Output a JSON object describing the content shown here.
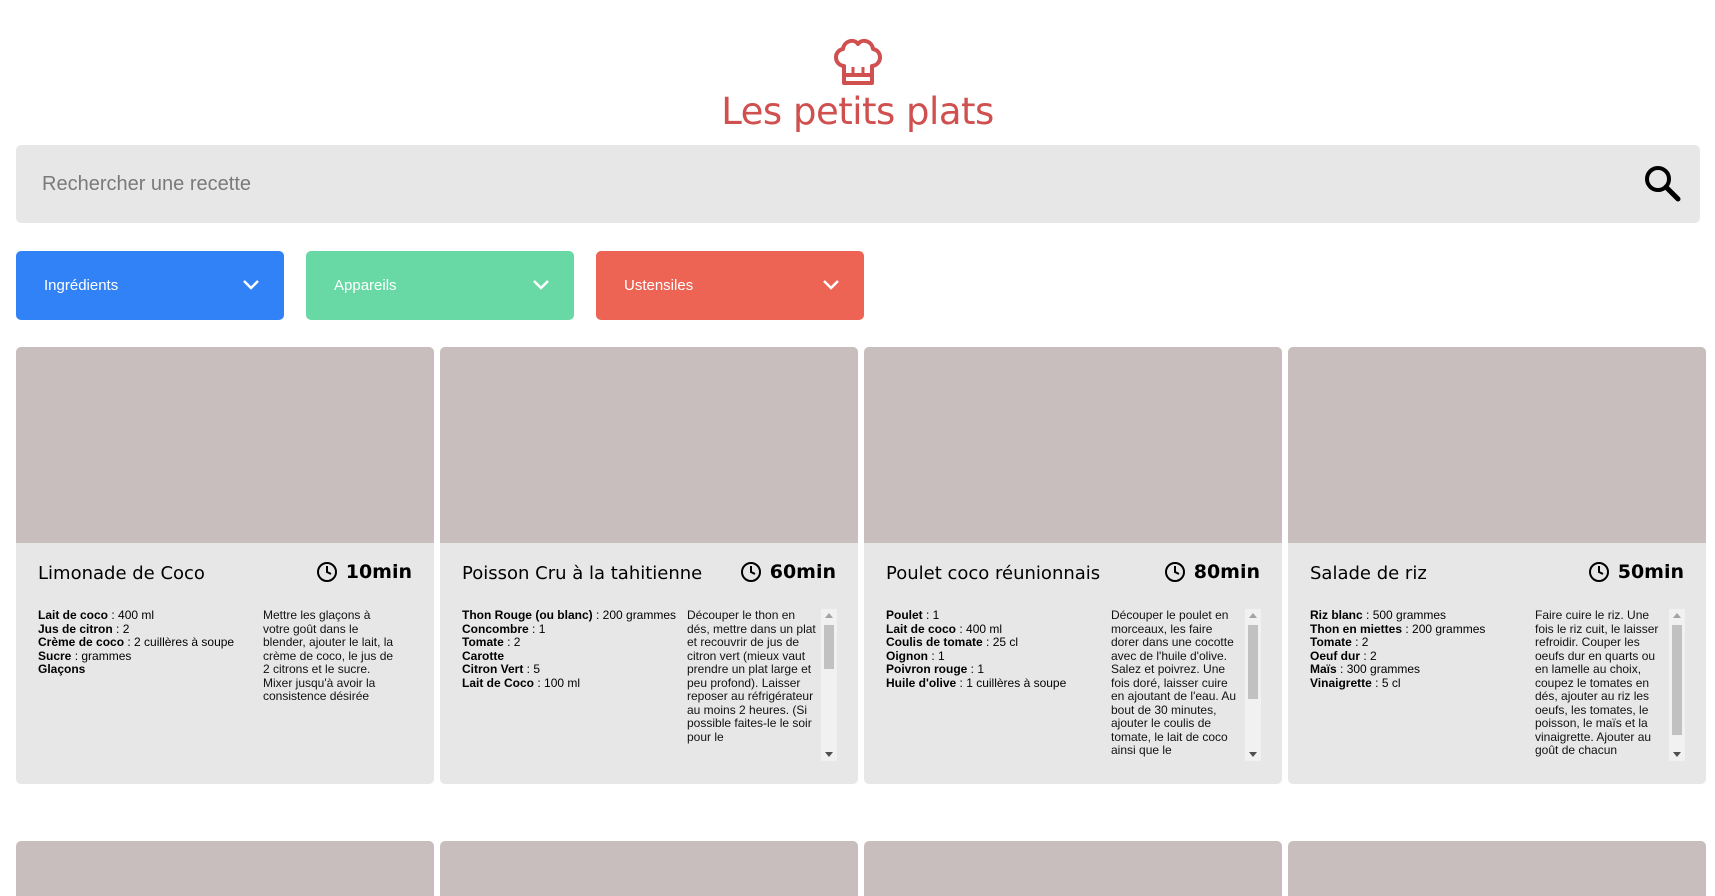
{
  "header": {
    "logo_icon": "chef-hat-icon",
    "title": "Les petits plats"
  },
  "search": {
    "placeholder": "Rechercher une recette",
    "value": "",
    "icon": "search-icon"
  },
  "filters": [
    {
      "label": "Ingrédients",
      "color": "#3282f7"
    },
    {
      "label": "Appareils",
      "color": "#68d9a4"
    },
    {
      "label": "Ustensiles",
      "color": "#ed6454"
    }
  ],
  "colors": {
    "brand": "#d04f4f",
    "image_placeholder": "#c7bebd",
    "card_background": "#e7e7e7"
  },
  "recipes": [
    {
      "name": "Limonade de Coco",
      "time": "10min",
      "ingredients": [
        {
          "name": "Lait de coco",
          "qty": " : 400 ml"
        },
        {
          "name": "Jus de citron",
          "qty": " : 2"
        },
        {
          "name": "Crème de coco",
          "qty": " : 2 cuillères à soupe"
        },
        {
          "name": "Sucre",
          "qty": " : grammes"
        },
        {
          "name": "Glaçons",
          "qty": ""
        }
      ],
      "description": "Mettre les glaçons à votre goût dans le blender, ajouter le lait, la crème de coco, le jus de 2 citrons et le sucre. Mixer jusqu'à avoir la consistence désirée",
      "scrollable": false
    },
    {
      "name": "Poisson Cru à la tahitienne",
      "time": "60min",
      "ingredients": [
        {
          "name": "Thon Rouge (ou blanc)",
          "qty": " : 200 grammes"
        },
        {
          "name": "Concombre",
          "qty": " : 1"
        },
        {
          "name": "Tomate",
          "qty": " : 2"
        },
        {
          "name": "Carotte",
          "qty": ""
        },
        {
          "name": "Citron Vert",
          "qty": " : 5"
        },
        {
          "name": "Lait de Coco",
          "qty": " : 100 ml"
        }
      ],
      "description": "Découper le thon en dés, mettre dans un plat et recouvrir de jus de citron vert (mieux vaut prendre un plat large et peu profond). Laisser reposer au réfrigérateur au moins 2 heures. (Si possible faites-le le soir pour le",
      "scrollable": true
    },
    {
      "name": "Poulet coco réunionnais",
      "time": "80min",
      "ingredients": [
        {
          "name": "Poulet",
          "qty": " : 1"
        },
        {
          "name": "Lait de coco",
          "qty": " : 400 ml"
        },
        {
          "name": "Coulis de tomate",
          "qty": " : 25 cl"
        },
        {
          "name": "Oignon",
          "qty": " : 1"
        },
        {
          "name": "Poivron rouge",
          "qty": " : 1"
        },
        {
          "name": "Huile d'olive",
          "qty": " : 1 cuillères à soupe"
        }
      ],
      "description": "Découper le poulet en morceaux, les faire dorer dans une cocotte avec de l'huile d'olive. Salez et poivrez. Une fois doré, laisser cuire en ajoutant de l'eau. Au bout de 30 minutes, ajouter le coulis de tomate, le lait de coco ainsi que le",
      "scrollable": true
    },
    {
      "name": "Salade de riz",
      "time": "50min",
      "ingredients": [
        {
          "name": "Riz blanc",
          "qty": " : 500 grammes"
        },
        {
          "name": "Thon en miettes",
          "qty": " : 200 grammes"
        },
        {
          "name": "Tomate",
          "qty": " : 2"
        },
        {
          "name": "Oeuf dur",
          "qty": " : 2"
        },
        {
          "name": "Maïs",
          "qty": " : 300 grammes"
        },
        {
          "name": "Vinaigrette",
          "qty": " : 5 cl"
        }
      ],
      "description": "Faire cuire le riz. Une fois le riz cuit, le laisser refroidir. Couper les oeufs dur en quarts ou en lamelle au choix, coupez le tomates en dés, ajouter au riz les oeufs, les tomates, le poisson, le maïs et la vinaigrette. Ajouter au goût de chacun",
      "scrollable": true
    }
  ]
}
